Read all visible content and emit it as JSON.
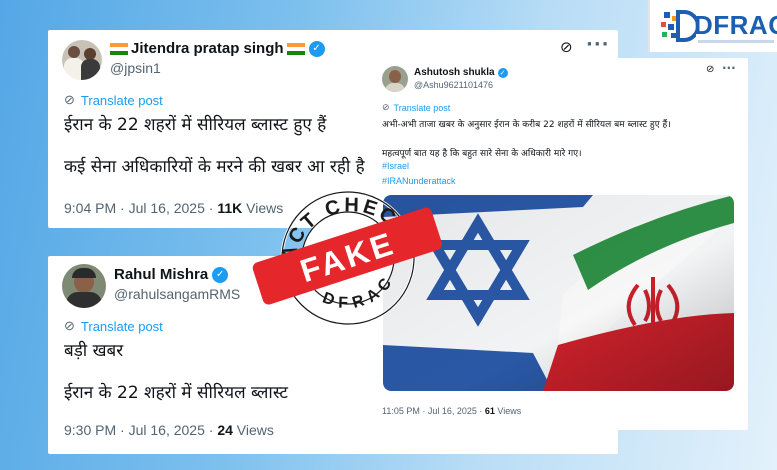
{
  "colors": {
    "accent": "#1d9bf0",
    "stamp_red": "#e5262b",
    "brand_blue": "#1c5fb0"
  },
  "logo": {
    "text": "DFRAC"
  },
  "stamp": {
    "top_text": "FACT CHECK",
    "bottom_text": "DFRAC",
    "label": "FAKE"
  },
  "tweet1": {
    "name": "Jitendra pratap singh",
    "handle": "@jpsin1",
    "translate": "Translate post",
    "line1": "ईरान के 22 शहरों में सीरियल ब्लास्ट हुए हैं",
    "line2": "कई सेना अधिकारियों के मरने की खबर आ रही है",
    "time": "9:04 PM · Jul 16, 2025 · ",
    "views_count": "11K",
    "views_label": " Views"
  },
  "tweet2": {
    "name": "Rahul Mishra",
    "handle": "@rahulsangamRMS",
    "translate": "Translate post",
    "line1": "बड़ी खबर",
    "line2": "ईरान के 22 शहरों में सीरियल ब्लास्ट",
    "time": "9:30 PM · Jul 16, 2025 · ",
    "views_count": "24",
    "views_label": " Views"
  },
  "tweet3": {
    "name": "Ashutosh shukla",
    "handle": "@Ashu9621101476",
    "translate": "Translate post",
    "line1": "अभी-अभी ताजा खबर के अनुसार ईरान के करीब 22 शहरों में सीरियल बम ब्लास्ट हुए हैं।",
    "line2": "महत्वपूर्ण बात यह है कि बहुत सारे सेना के अधिकारी मारे गए।",
    "hashtag1": "#Israel",
    "hashtag2": "#IRANunderattack",
    "time": "11:05 PM · Jul 16, 2025 · ",
    "views_count": "61",
    "views_label": " Views"
  }
}
